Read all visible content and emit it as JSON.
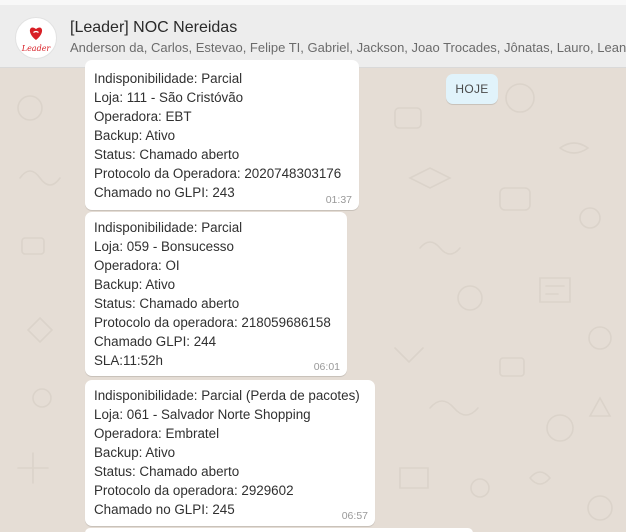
{
  "header": {
    "group_name": "[Leader] NOC Nereidas",
    "participants": "Anderson da, Carlos, Estevao, Felipe TI, Gabriel, Jackson, Joao Trocades, Jônatas, Lauro, Leandro, L",
    "avatar_logo_text": "Leader",
    "avatar_brand_color": "#d81f26"
  },
  "day_label": "HOJE",
  "messages": [
    {
      "lines": [
        "Indisponibilidade: Parcial",
        "Loja: 111 - São Cristóvão",
        "Operadora: EBT",
        "Backup: Ativo",
        "Status: Chamado aberto",
        "Protocolo da Operadora: 2020748303176",
        "Chamado no GLPI: 243"
      ],
      "time": "01:37"
    },
    {
      "lines": [
        "Indisponibilidade: Parcial",
        "Loja: 059 - Bonsucesso",
        "Operadora: OI",
        "Backup: Ativo",
        "Status: Chamado aberto",
        "Protocolo da operadora: 218059686158",
        "Chamado GLPI: 244",
        "SLA:11:52h"
      ],
      "time": "06:01"
    },
    {
      "lines": [
        "Indisponibilidade: Parcial (Perda de pacotes)",
        "Loja: 061 - Salvador Norte Shopping",
        "Operadora: Embratel",
        "Backup: Ativo",
        "Status: Chamado aberto",
        "Protocolo da operadora: 2929602",
        "Chamado no GLPI: 245"
      ],
      "time": "06:57"
    }
  ],
  "colors": {
    "chat_background": "#e5ddd5",
    "header_background": "#ededed",
    "bubble_background": "#ffffff",
    "day_pill_background": "#e1f3fb"
  }
}
